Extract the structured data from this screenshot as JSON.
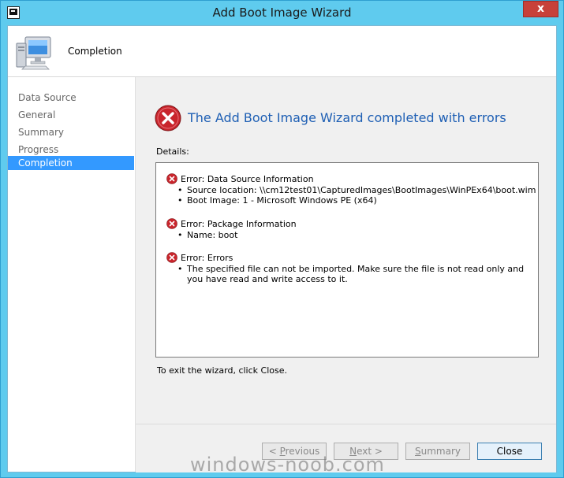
{
  "window": {
    "title": "Add Boot Image Wizard",
    "close_glyph": "x"
  },
  "header": {
    "icon": "computer-icon",
    "title": "Completion"
  },
  "sidebar": {
    "items": [
      {
        "label": "Data Source",
        "active": false
      },
      {
        "label": "General",
        "active": false
      },
      {
        "label": "Summary",
        "active": false
      },
      {
        "label": "Progress",
        "active": false
      },
      {
        "label": "Completion",
        "active": true
      }
    ]
  },
  "main": {
    "heading": "The Add Boot Image Wizard completed with errors",
    "details_label": "Details:",
    "errors": [
      {
        "title": "Error: Data Source Information",
        "bullets": [
          "Source location: \\\\cm12test01\\CapturedImages\\BootImages\\WinPEx64\\boot.wim",
          "Boot Image: 1 - Microsoft Windows PE (x64)"
        ]
      },
      {
        "title": "Error: Package Information",
        "bullets": [
          "Name: boot"
        ]
      },
      {
        "title": "Error: Errors",
        "bullets": [
          "The specified file can not be imported. Make sure the file is not read only and you have read and write access to it."
        ]
      }
    ],
    "exit_text": "To exit the wizard, click Close."
  },
  "footer": {
    "previous": {
      "prefix": "< ",
      "accel": "P",
      "rest": "revious"
    },
    "next": {
      "accel": "N",
      "rest": "ext >"
    },
    "summary": {
      "accel": "S",
      "rest": "ummary"
    },
    "close": "Close"
  },
  "watermark": "windows-noob.com",
  "colors": {
    "title_bar": "#5fcbee",
    "heading": "#1e5fb4",
    "selection": "#3399ff",
    "error_red": "#c9252c"
  }
}
